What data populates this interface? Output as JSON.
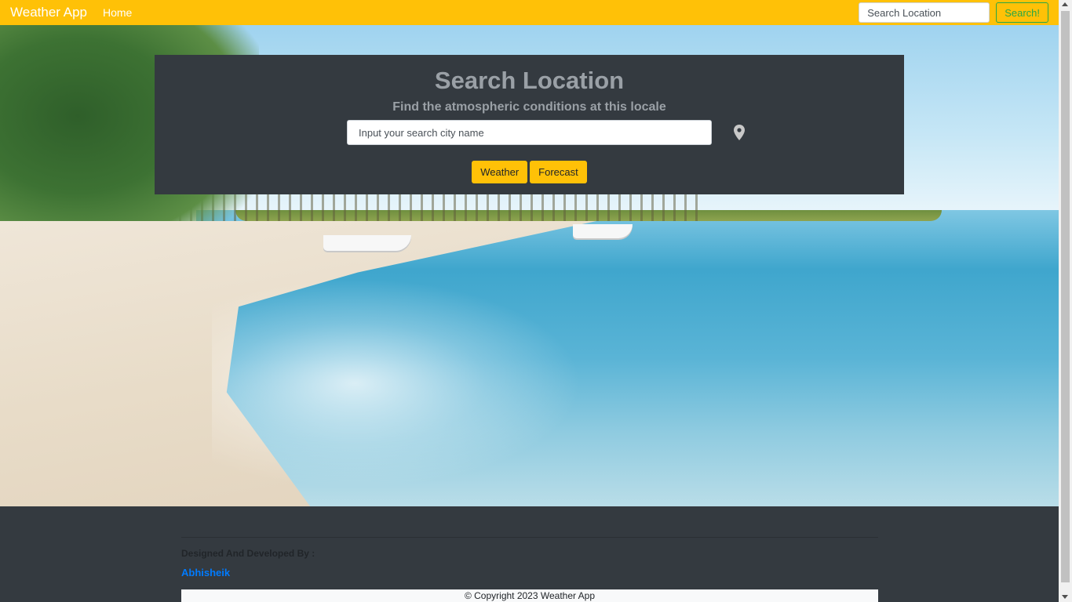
{
  "navbar": {
    "brand": "Weather App",
    "home_link": "Home",
    "search_placeholder": "Search Location",
    "search_button": "Search!"
  },
  "hero": {
    "background_image": "beach-scene"
  },
  "search_panel": {
    "title": "Search Location",
    "subtitle": "Find the atmospheric conditions at this locale",
    "input_placeholder": "Input your search city name",
    "location_icon": "map-pin-icon",
    "buttons": {
      "weather": "Weather",
      "forecast": "Forecast"
    }
  },
  "footer": {
    "designed_by": "Designed And Developed By :",
    "author": "Abhisheik",
    "copyright": "© Copyright 2023 Weather App"
  },
  "colors": {
    "accent_yellow": "#ffc107",
    "dark_panel": "#343a40",
    "success_green": "#28a745",
    "link_blue": "#007bff"
  }
}
